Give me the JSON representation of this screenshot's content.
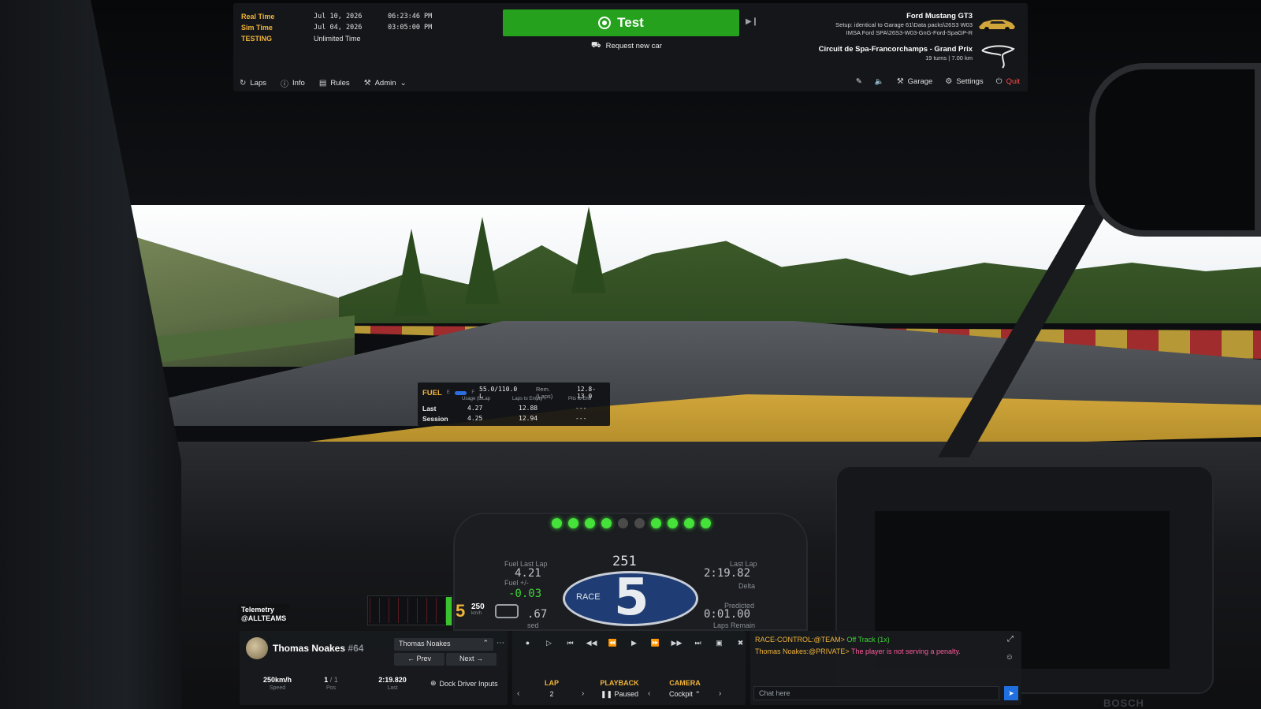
{
  "session": {
    "real_time_label": "Real Time",
    "real_time_date": "Jul 10, 2026",
    "real_time_clock": "06:23:46 PM",
    "sim_time_label": "Sim Time",
    "sim_time_date": "Jul 04, 2026",
    "sim_time_clock": "03:05:00 PM",
    "mode_label": "TESTING",
    "mode_value": "Unlimited Time"
  },
  "actions": {
    "test_label": "Test",
    "request_label": "Request new car"
  },
  "car": {
    "name": "Ford Mustang GT3",
    "setup_line": "Setup: identical to Garage 61\\Data packs\\26S3 W03",
    "setup_path": "IMSA Ford SPA\\26S3-W03-GnG-Ford-SpaGP-R"
  },
  "track": {
    "name": "Circuit de Spa-Francorchamps - Grand Prix",
    "turns": "19 turns",
    "length": "7.00 km"
  },
  "menu": {
    "left": [
      "Laps",
      "Info",
      "Rules",
      "Admin"
    ],
    "garage": "Garage",
    "settings": "Settings",
    "quit": "Quit"
  },
  "fuel": {
    "title": "FUEL",
    "e": "E",
    "f": "F",
    "amount": "55.0/110.0 L",
    "rem_label": "Rem. (Laps)",
    "rem_value": "12.8-13.0",
    "col_usage": "Usage (L/Lap",
    "col_laps": "Laps to Empty",
    "col_pits": "Pits to End",
    "rows": [
      {
        "label": "Last",
        "usage": "4.27",
        "laps": "12.88",
        "pits": "---"
      },
      {
        "label": "Session",
        "usage": "4.25",
        "laps": "12.94",
        "pits": "---"
      }
    ]
  },
  "dash": {
    "rpm": "251",
    "fuel_last_lap_label": "Fuel Last Lap",
    "fuel_last_lap": "4.21",
    "fuel_delta_label": "Fuel +/-",
    "fuel_delta": "-0.03",
    "last_lap_label": "Last Lap",
    "last_lap": "2:19.82",
    "delta_label": "Delta",
    "predicted_label": "Predicted",
    "predicted": "0:01.00",
    "laps_remain_label": "Laps Remain",
    "partial_value": ".67",
    "partial_label": "sed",
    "gear": "5",
    "mode": "RACE",
    "leds": [
      true,
      true,
      true,
      true,
      false,
      false,
      true,
      true,
      true,
      true
    ]
  },
  "telemetry": {
    "line1": "Telemetry",
    "line2": "@ALLTEAMS",
    "gear": "5",
    "speed": "250",
    "speed_unit": "km/h"
  },
  "driver": {
    "name": "Thomas Noakes",
    "number": "#64",
    "selected": "Thomas Noakes",
    "prev": "Prev",
    "next": "Next",
    "speed_value": "250km/h",
    "speed_label": "Speed",
    "pos_value": "1",
    "pos_total": "1",
    "pos_label": "Pos",
    "last_value": "2:19.820",
    "last_label": "Last",
    "dock_label": "Dock Driver Inputs"
  },
  "playback": {
    "lap_label": "LAP",
    "lap_value": "2",
    "playback_label": "PLAYBACK",
    "playback_value": "Paused",
    "camera_label": "CAMERA",
    "camera_value": "Cockpit"
  },
  "chat": {
    "msg1_src": "RACE-CONTROL:@TEAM>",
    "msg1_text": "Off Track (1x)",
    "msg2_src": "Thomas Noakes:@PRIVATE>",
    "msg2_text": "The player is not serving a penalty.",
    "placeholder": "Chat here"
  },
  "branding": "BOSCH",
  "colors": {
    "accent": "#f1b43a",
    "test_button": "#25a11d",
    "quit": "#ff4b4b",
    "send": "#1f6fe0"
  }
}
